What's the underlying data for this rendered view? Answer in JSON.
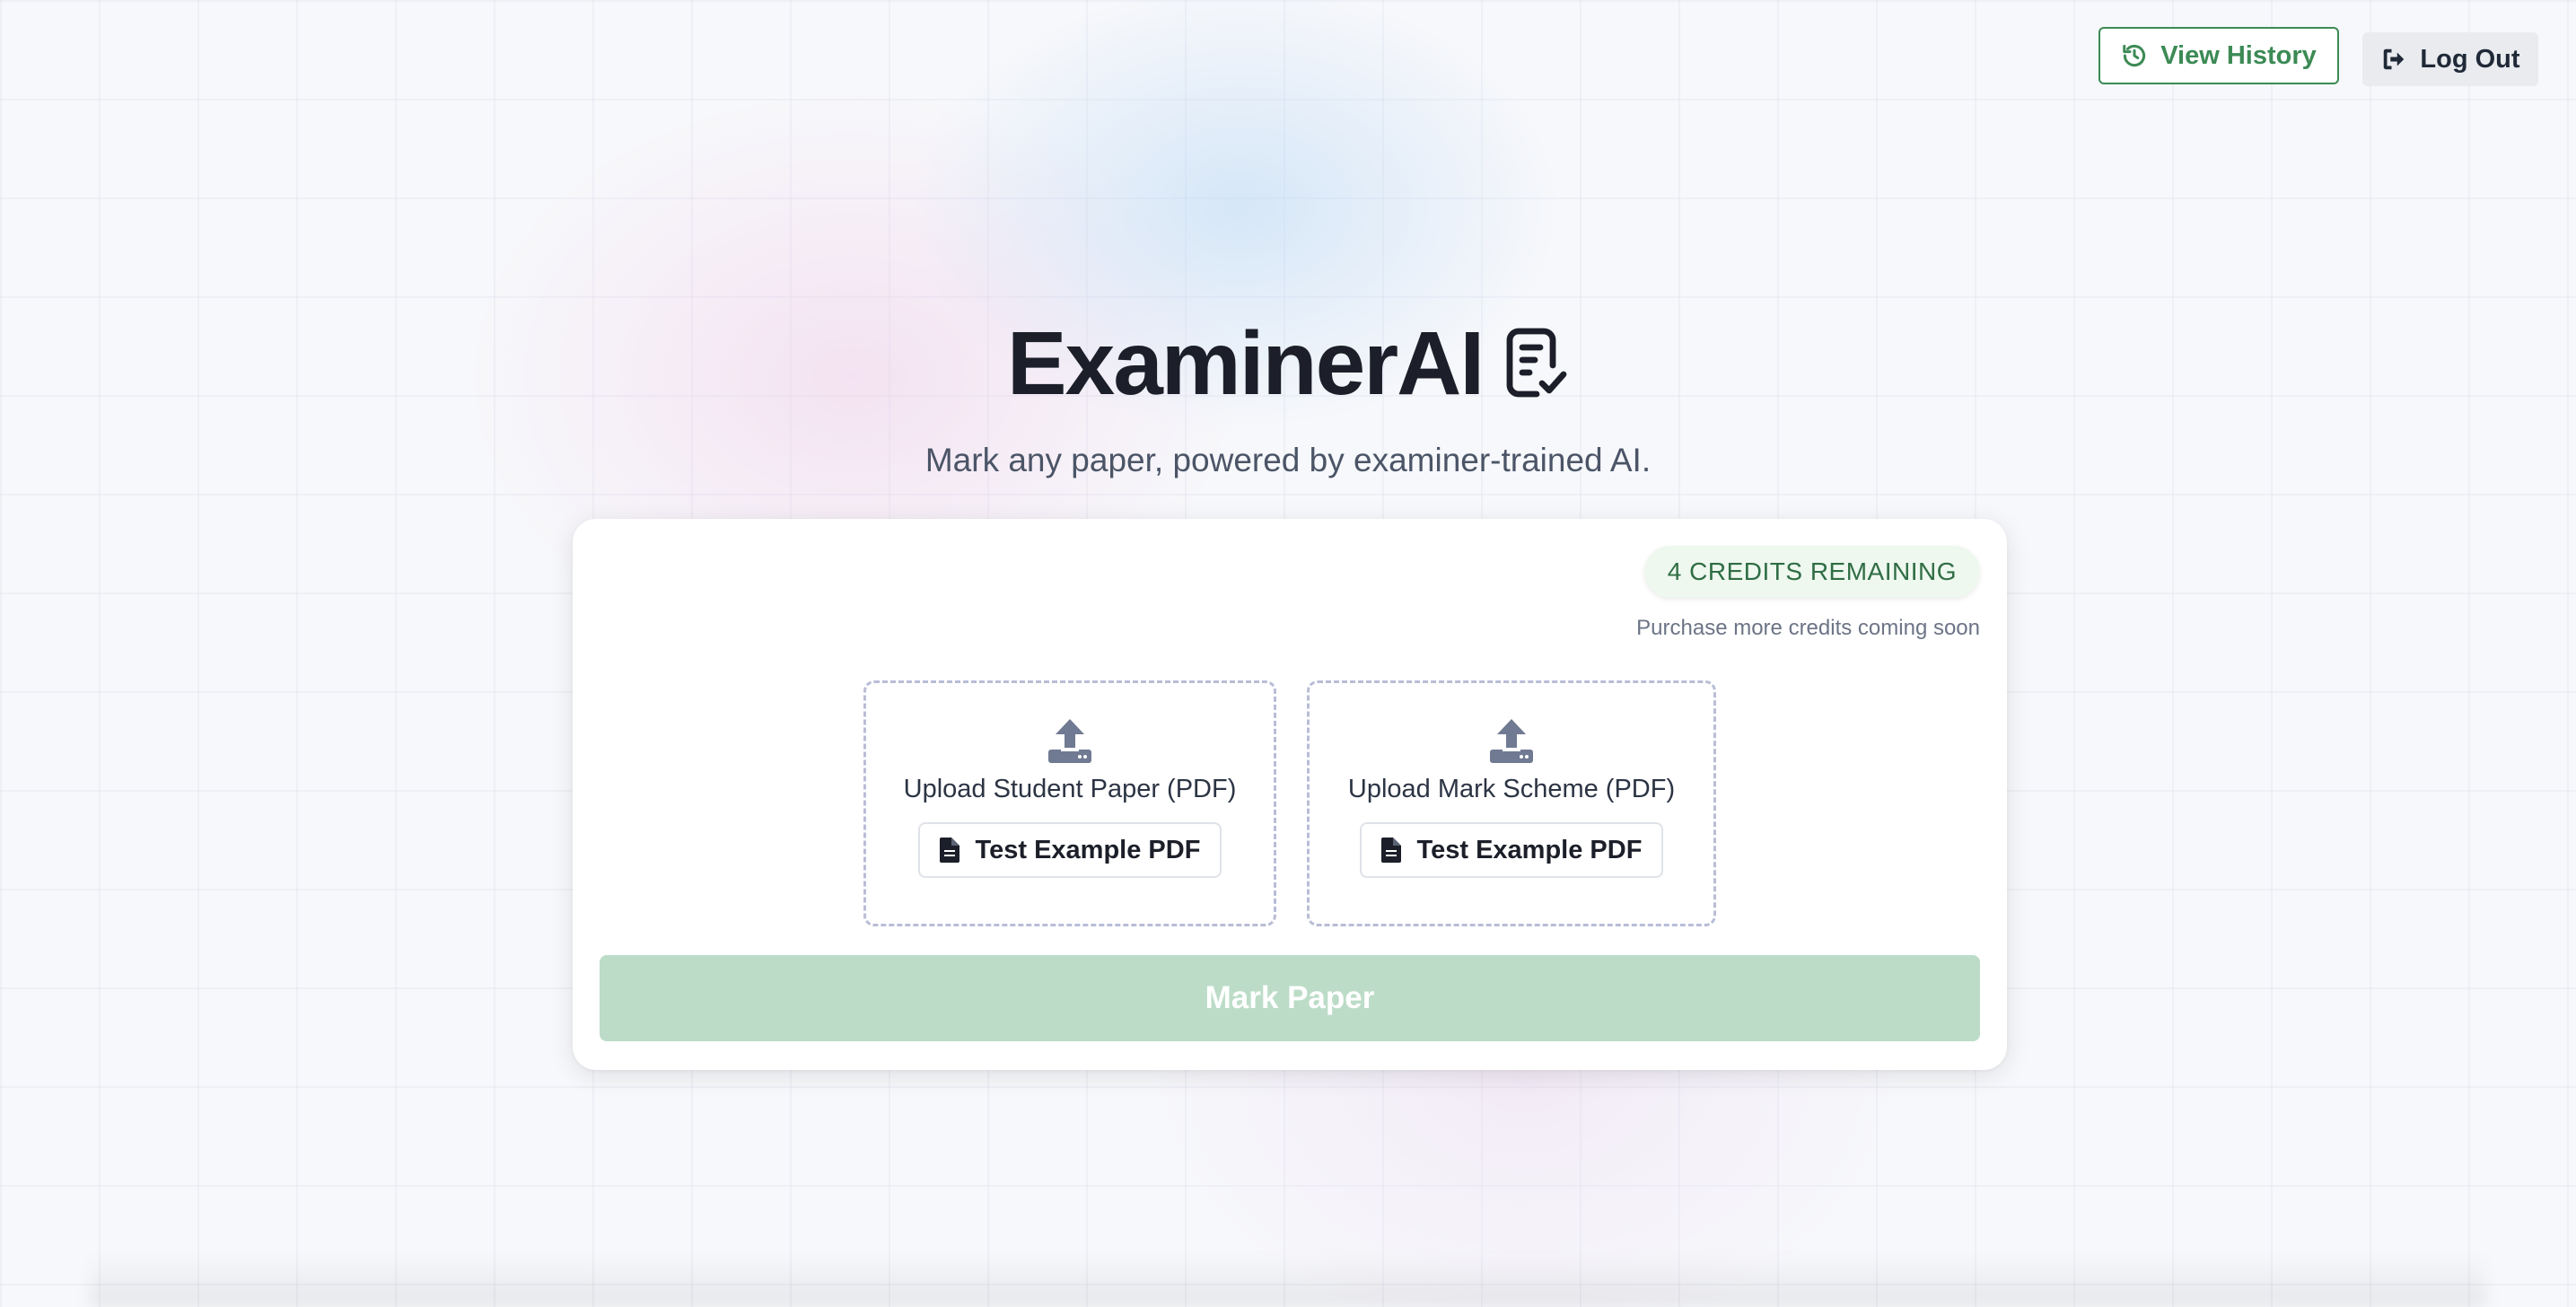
{
  "header": {
    "view_history_label": "View History",
    "log_out_label": "Log Out",
    "history_icon": "history-icon",
    "logout_icon": "logout-icon"
  },
  "hero": {
    "title": "ExaminerAI",
    "title_icon": "document-check-icon",
    "subtitle": "Mark any paper, powered by examiner-trained AI."
  },
  "card": {
    "credits_badge": "4 CREDITS REMAINING",
    "purchase_note": "Purchase more credits coming soon",
    "uploads": [
      {
        "label": "Upload Student Paper (PDF)",
        "icon": "upload-icon",
        "example_button_label": "Test Example PDF",
        "example_icon": "file-icon"
      },
      {
        "label": "Upload Mark Scheme (PDF)",
        "icon": "upload-icon",
        "example_button_label": "Test Example PDF",
        "example_icon": "file-icon"
      }
    ],
    "mark_button_label": "Mark Paper"
  },
  "colors": {
    "accent_green": "#3c8a55",
    "mark_button_disabled": "#bcdcc8",
    "badge_bg": "#eef8ef",
    "badge_text": "#2f6d44",
    "title_text": "#1c1f29"
  }
}
